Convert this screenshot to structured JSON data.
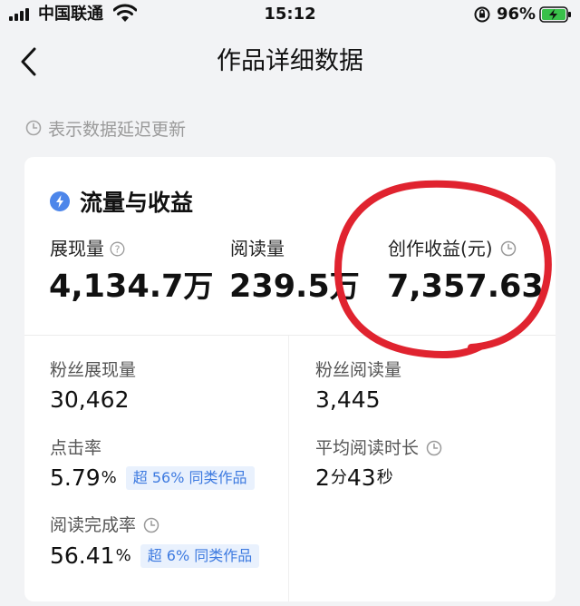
{
  "status_bar": {
    "carrier": "中国联通",
    "time": "15:12",
    "battery_percent": "96%"
  },
  "nav": {
    "title": "作品详细数据"
  },
  "notice": {
    "text": "表示数据延迟更新"
  },
  "card": {
    "title": "流量与收益",
    "top_metrics": [
      {
        "label": "展现量",
        "value": "4,134.7",
        "unit": "万"
      },
      {
        "label": "阅读量",
        "value": "239.5",
        "unit": "万"
      },
      {
        "label": "创作收益(元)",
        "value": "7,357.63",
        "unit": ""
      }
    ],
    "stats": {
      "fan_impressions": {
        "label": "粉丝展现量",
        "value": "30,462"
      },
      "fan_reads": {
        "label": "粉丝阅读量",
        "value": "3,445"
      },
      "ctr": {
        "label": "点击率",
        "value": "5.79",
        "unit": "%",
        "badge": "超 56% 同类作品"
      },
      "avg_read_time": {
        "label": "平均阅读时长",
        "minutes": "2",
        "minutes_unit": "分",
        "seconds": "43",
        "seconds_unit": "秒"
      },
      "completion": {
        "label": "阅读完成率",
        "value": "56.41",
        "unit": "%",
        "badge": "超 6% 同类作品"
      }
    }
  },
  "colors": {
    "accent_blue": "#3d7ae0",
    "annotation_red": "#e0232f",
    "badge_bg": "#e9f1fd"
  },
  "icons": {
    "back": "chevron-left-icon",
    "clock": "clock-icon",
    "bolt": "lightning-icon",
    "help": "question-icon"
  }
}
